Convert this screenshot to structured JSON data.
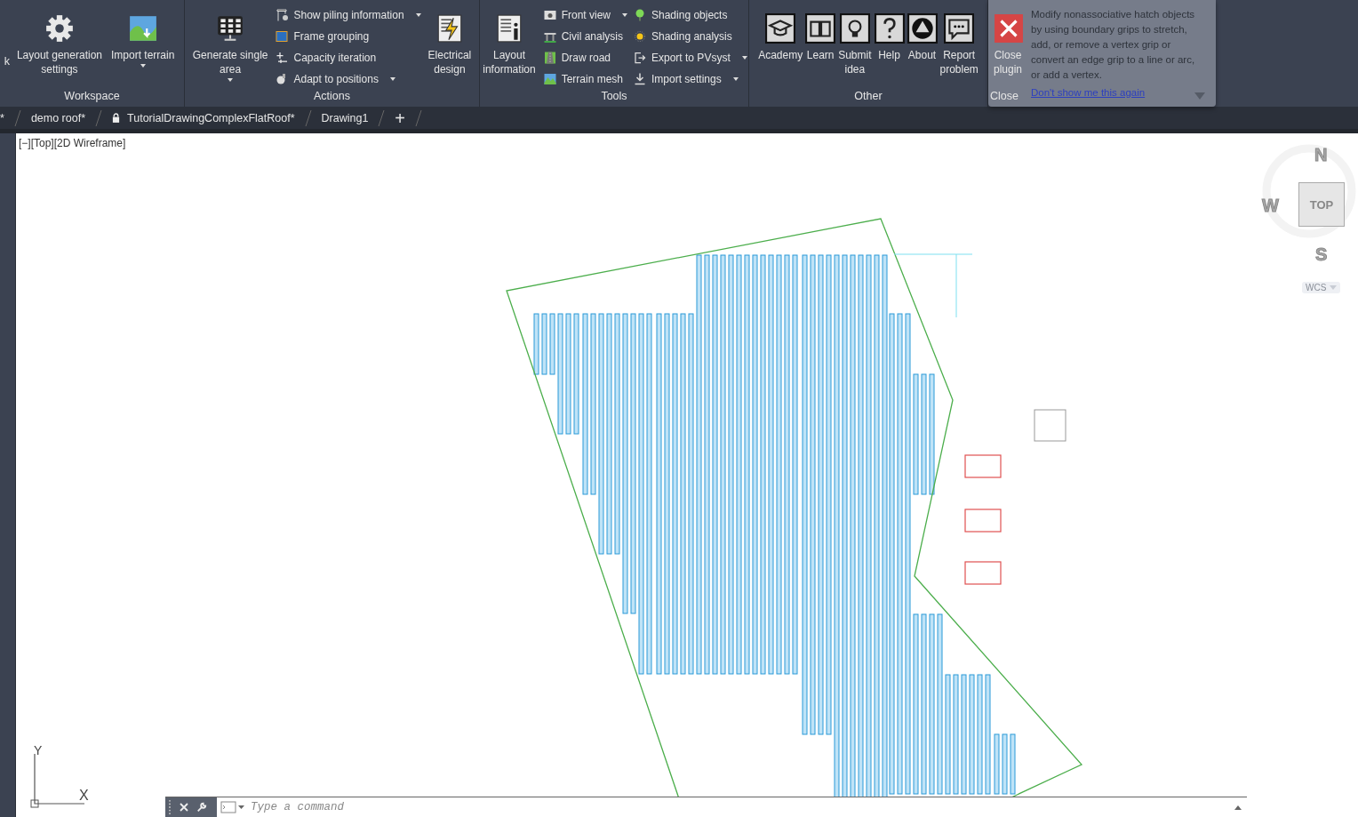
{
  "ribbon": {
    "panels": [
      {
        "title": "Workspace",
        "cut_label": "k",
        "groups": [
          {
            "kind": "large",
            "label": [
              "Layout generation",
              "settings"
            ],
            "dropdown": false
          },
          {
            "kind": "large",
            "label": [
              "Import terrain"
            ],
            "dropdown": true
          }
        ]
      },
      {
        "title": "Actions",
        "groups": [
          {
            "kind": "large",
            "label": [
              "Generate single",
              "area"
            ],
            "dropdown": true
          },
          {
            "kind": "stack",
            "items": [
              {
                "label": "Show piling information",
                "dropdown": true
              },
              {
                "label": "Frame grouping",
                "dropdown": false
              },
              {
                "label": "Capacity iteration",
                "dropdown": false
              },
              {
                "label": "Adapt to positions",
                "dropdown": true
              }
            ]
          },
          {
            "kind": "large",
            "label": [
              "Electrical",
              "design"
            ],
            "dropdown": false
          }
        ]
      },
      {
        "title": "Tools",
        "groups": [
          {
            "kind": "large",
            "label": [
              "Layout",
              "information"
            ],
            "dropdown": false
          },
          {
            "kind": "stack",
            "items": [
              {
                "label": "Front view",
                "dropdown": true
              },
              {
                "label": "Civil analysis",
                "dropdown": false
              },
              {
                "label": "Draw road",
                "dropdown": false
              },
              {
                "label": "Terrain mesh",
                "dropdown": false
              }
            ]
          },
          {
            "kind": "stack",
            "items": [
              {
                "label": "Shading objects",
                "dropdown": false
              },
              {
                "label": "Shading analysis",
                "dropdown": false
              },
              {
                "label": "Export to PVsyst",
                "dropdown": true
              },
              {
                "label": "Import settings",
                "dropdown": true
              }
            ]
          }
        ]
      },
      {
        "title": "Other",
        "groups": [
          {
            "kind": "large",
            "label": [
              "Academy"
            ],
            "dropdown": false
          },
          {
            "kind": "large",
            "label": [
              "Learn"
            ],
            "dropdown": false
          },
          {
            "kind": "large",
            "label": [
              "Submit",
              "idea"
            ],
            "dropdown": false
          },
          {
            "kind": "large",
            "label": [
              "Help"
            ],
            "dropdown": false
          },
          {
            "kind": "large",
            "label": [
              "About"
            ],
            "dropdown": false
          },
          {
            "kind": "large",
            "label": [
              "Report",
              "problem"
            ],
            "dropdown": false
          }
        ]
      },
      {
        "title": "Close",
        "groups": [
          {
            "kind": "large",
            "label": [
              "Close",
              "plugin"
            ],
            "dropdown": false
          }
        ]
      }
    ]
  },
  "tabs": [
    {
      "label": "*",
      "locked": false
    },
    {
      "label": "demo roof*",
      "locked": false
    },
    {
      "label": "TutorialDrawingComplexFlatRoof*",
      "locked": true
    },
    {
      "label": "Drawing1",
      "locked": false
    }
  ],
  "new_tab": "+",
  "viewport": {
    "label": "[−][Top][2D Wireframe]"
  },
  "viewcube": {
    "north": "N",
    "west": "W",
    "south": "S",
    "face": "TOP",
    "coordinate_system": "WCS"
  },
  "ucs": {
    "y_label": "Y",
    "x_label": "X"
  },
  "tooltip": {
    "text": "Modify nonassociative hatch objects by using boundary grips to stretch, add, or remove a vertex grip or convert an edge grip to a line or arc, or add a vertex.",
    "link": "Don't show me this again"
  },
  "command_line": {
    "placeholder": "Type a command"
  }
}
